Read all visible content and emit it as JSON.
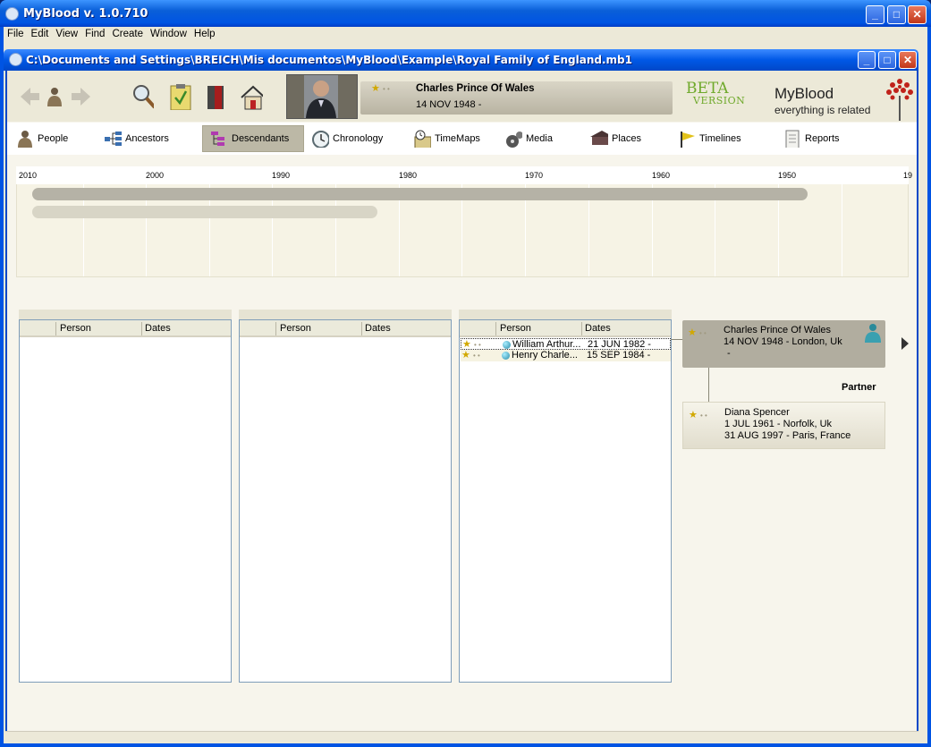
{
  "window": {
    "title": "MyBlood v. 1.0.710"
  },
  "menu": [
    "File",
    "Edit",
    "View",
    "Find",
    "Create",
    "Window",
    "Help"
  ],
  "document": {
    "title": "C:\\Documents and Settings\\BREICH\\Mis documentos\\MyBlood\\Example\\Royal Family of England.mb1"
  },
  "current_person": {
    "name": "Charles Prince Of Wales",
    "date": "14 NOV 1948 -"
  },
  "branding": {
    "beta": "BETA",
    "version": "VERSION",
    "app": "MyBlood",
    "tagline": "everything is related",
    "accent": "#6fa92b"
  },
  "tabs": [
    {
      "label": "People",
      "icon": "person-icon"
    },
    {
      "label": "Ancestors",
      "icon": "ancestors-tree-icon"
    },
    {
      "label": "Descendants",
      "icon": "descendants-tree-icon",
      "selected": true
    },
    {
      "label": "Chronology",
      "icon": "clock-icon"
    },
    {
      "label": "TimeMaps",
      "icon": "timemap-icon"
    },
    {
      "label": "Media",
      "icon": "film-reel-icon"
    },
    {
      "label": "Places",
      "icon": "house-icon"
    },
    {
      "label": "Timelines",
      "icon": "flag-icon"
    },
    {
      "label": "Reports",
      "icon": "document-icon"
    }
  ],
  "timeline": {
    "years": [
      "2010",
      "2000",
      "1990",
      "1980",
      "1970",
      "1960",
      "1950",
      "19"
    ]
  },
  "panels": [
    {
      "headers": [
        "Person",
        "Dates"
      ],
      "rows": []
    },
    {
      "headers": [
        "Person",
        "Dates"
      ],
      "rows": []
    },
    {
      "headers": [
        "Person",
        "Dates"
      ],
      "rows": [
        {
          "name": "William Arthur...",
          "dates": "21 JUN 1982 -"
        },
        {
          "name": "Henry Charle...",
          "dates": "15 SEP 1984 -"
        }
      ]
    }
  ],
  "main_card": {
    "name": "Charles Prince Of Wales",
    "line2": "14 NOV 1948 - London, Uk",
    "line3": "-"
  },
  "partner_label": "Partner",
  "partner_card": {
    "name": "Diana Spencer",
    "line2": "1 JUL 1961 - Norfolk, Uk",
    "line3": "31 AUG 1997 - Paris, France"
  }
}
